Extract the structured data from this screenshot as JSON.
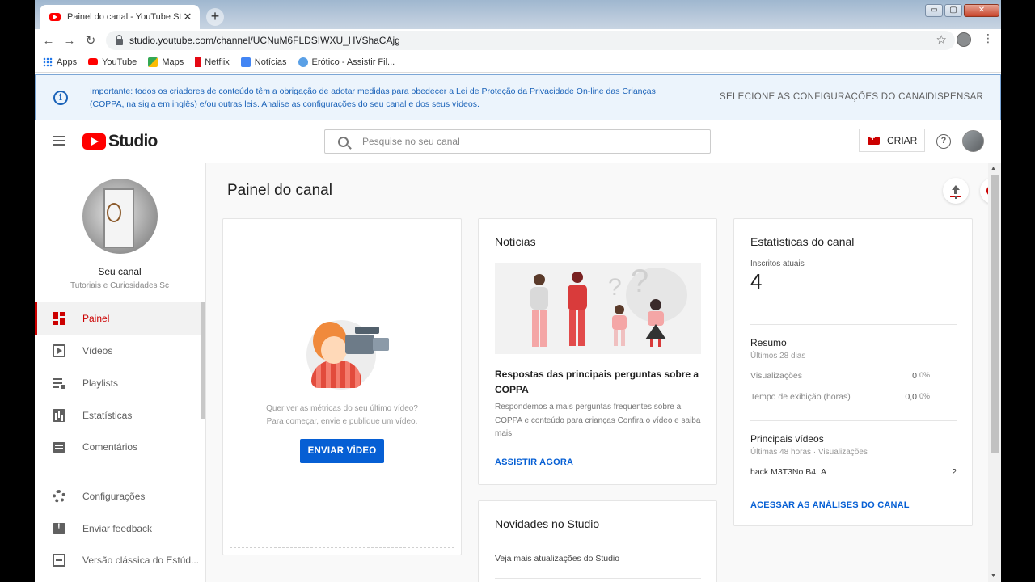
{
  "browser": {
    "tab_title": "Painel do canal - YouTube Studio",
    "tab_close": "✕",
    "new_tab": "+",
    "window_controls": {
      "minimize": "▭",
      "maximize": "▢",
      "close": "✕"
    },
    "back": "←",
    "forward": "→",
    "reload": "↻",
    "url": "studio.youtube.com/channel/UCNuM6FLDSIWXU_HVShaCAjg",
    "star": "☆",
    "menu": "⋮",
    "bookmarks": [
      "Apps",
      "YouTube",
      "Maps",
      "Netflix",
      "Notícias",
      "Erótico - Assistir Fil..."
    ]
  },
  "notice": {
    "text": "Importante: todos os criadores de conteúdo têm a obrigação de adotar medidas para obedecer a Lei de Proteção da Privacidade On-line das Crianças (COPPA, na sigla em inglês) e/ou outras leis. Analise as configurações do seu canal e dos seus vídeos.",
    "info_glyph": "i",
    "action_primary": "SELECIONE AS CONFIGURAÇÕES DO CANAL",
    "action_dismiss": "DISPENSAR"
  },
  "header": {
    "logo_text": "Studio",
    "search_placeholder": "Pesquise no seu canal",
    "create_label": "CRIAR",
    "help_glyph": "?"
  },
  "sidebar": {
    "channel_title": "Seu canal",
    "channel_name": "Tutoriais e Curiosidades Sc",
    "items": [
      {
        "label": "Painel",
        "icon": "dashboard-icon",
        "active": true
      },
      {
        "label": "Vídeos",
        "icon": "videos-icon"
      },
      {
        "label": "Playlists",
        "icon": "playlist-icon"
      },
      {
        "label": "Estatísticas",
        "icon": "analytics-icon"
      },
      {
        "label": "Comentários",
        "icon": "comments-icon"
      }
    ],
    "secondary_items": [
      {
        "label": "Configurações",
        "icon": "gear-icon"
      },
      {
        "label": "Enviar feedback",
        "icon": "feedback-icon"
      },
      {
        "label": "Versão clássica do Estúd...",
        "icon": "classic-studio-icon"
      }
    ]
  },
  "main": {
    "title": "Painel do canal",
    "upload_card": {
      "prompt_line1": "Quer ver as métricas do seu último vídeo?",
      "prompt_line2": "Para começar, envie e publique um vídeo.",
      "button": "ENVIAR VÍDEO"
    },
    "news_card": {
      "title": "Notícias",
      "headline": "Respostas das principais perguntas sobre a COPPA",
      "body": "Respondemos a mais perguntas frequentes sobre a COPPA e conteúdo para crianças Confira o vídeo e saiba mais.",
      "link": "ASSISTIR AGORA"
    },
    "studio_news_card": {
      "title": "Novidades no Studio",
      "subtitle": "Veja mais atualizações do Studio"
    },
    "stats_card": {
      "title": "Estatísticas do canal",
      "subs_label": "Inscritos atuais",
      "subs_value": "4",
      "summary_title": "Resumo",
      "summary_period": "Últimos 28 dias",
      "views_label": "Visualizações",
      "views_value": "0",
      "views_pct": "0%",
      "watch_label": "Tempo de exibição (horas)",
      "watch_value": "0,0",
      "watch_pct": "0%",
      "top_videos_title": "Principais vídeos",
      "top_videos_period": "Últimas 48 horas · Visualizações",
      "top_video_name": "hack M3T3No B4LA",
      "top_video_views": "2",
      "link": "ACESSAR AS ANÁLISES DO CANAL"
    }
  },
  "colors": {
    "accent_red": "#cc0000",
    "link_blue": "#065fd4",
    "notice_blue": "#1a62b8"
  }
}
